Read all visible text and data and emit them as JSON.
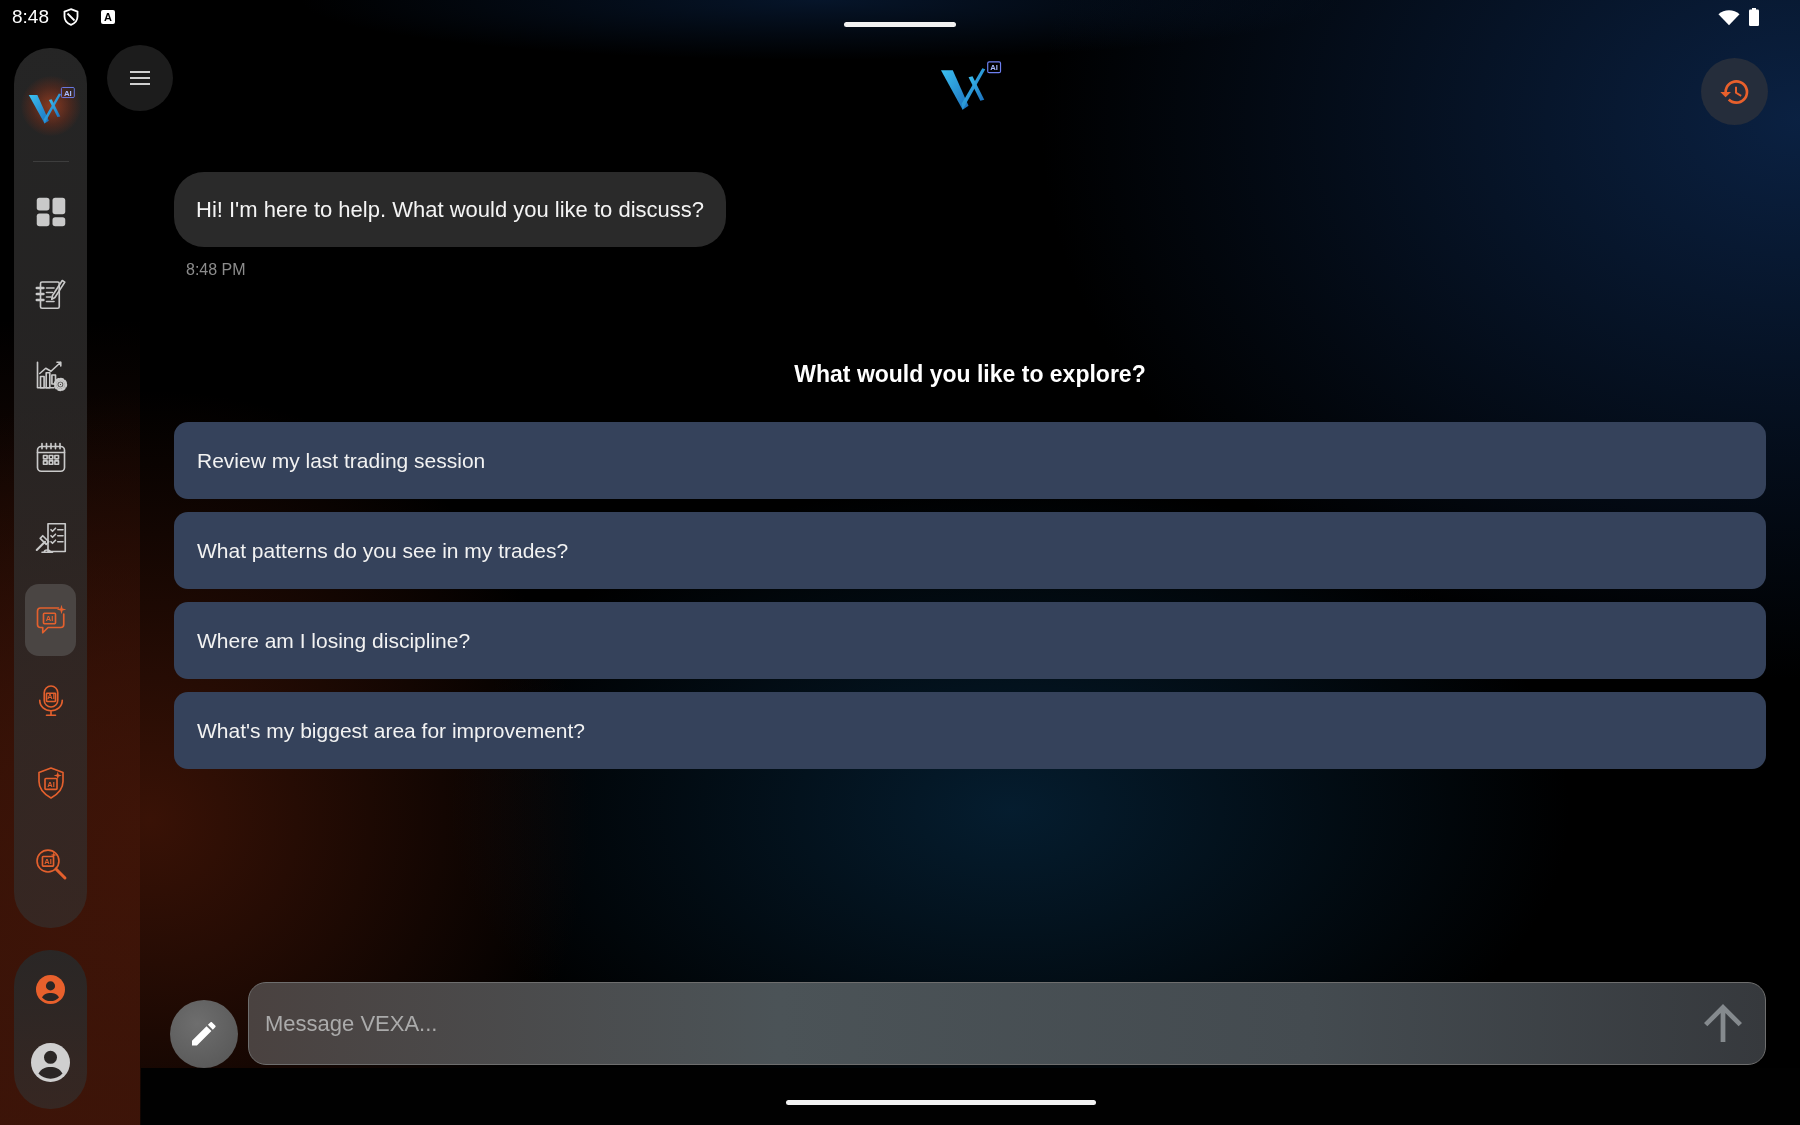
{
  "status_bar": {
    "time": "8:48",
    "notification": "A"
  },
  "sidebar": {
    "logo_badge": "AI",
    "items": [
      {
        "kind": "dashboard",
        "selected": false
      },
      {
        "kind": "journal",
        "selected": false
      },
      {
        "kind": "analytics",
        "selected": false
      },
      {
        "kind": "calendar",
        "selected": false
      },
      {
        "kind": "rules",
        "selected": false
      },
      {
        "kind": "ai-chat",
        "badge": "AI",
        "selected": true
      },
      {
        "kind": "ai-voice",
        "badge": "AI",
        "selected": false
      },
      {
        "kind": "ai-shield",
        "badge": "AI",
        "selected": false
      },
      {
        "kind": "ai-search",
        "badge": "AI",
        "selected": false
      }
    ],
    "account_items": [
      {
        "kind": "profile"
      },
      {
        "kind": "avatar"
      }
    ]
  },
  "header": {
    "logo_badge": "AI"
  },
  "chat": {
    "messages": [
      {
        "text": "Hi! I'm here to help. What would you like to discuss?",
        "time": "8:48 PM"
      }
    ]
  },
  "suggestions": {
    "title": "What would you like to explore?",
    "items": [
      "Review my last trading session",
      "What patterns do you see in my trades?",
      "Where am I losing discipline?",
      "What's my biggest area for improvement?"
    ]
  },
  "composer": {
    "placeholder": "Message VEXA..."
  }
}
